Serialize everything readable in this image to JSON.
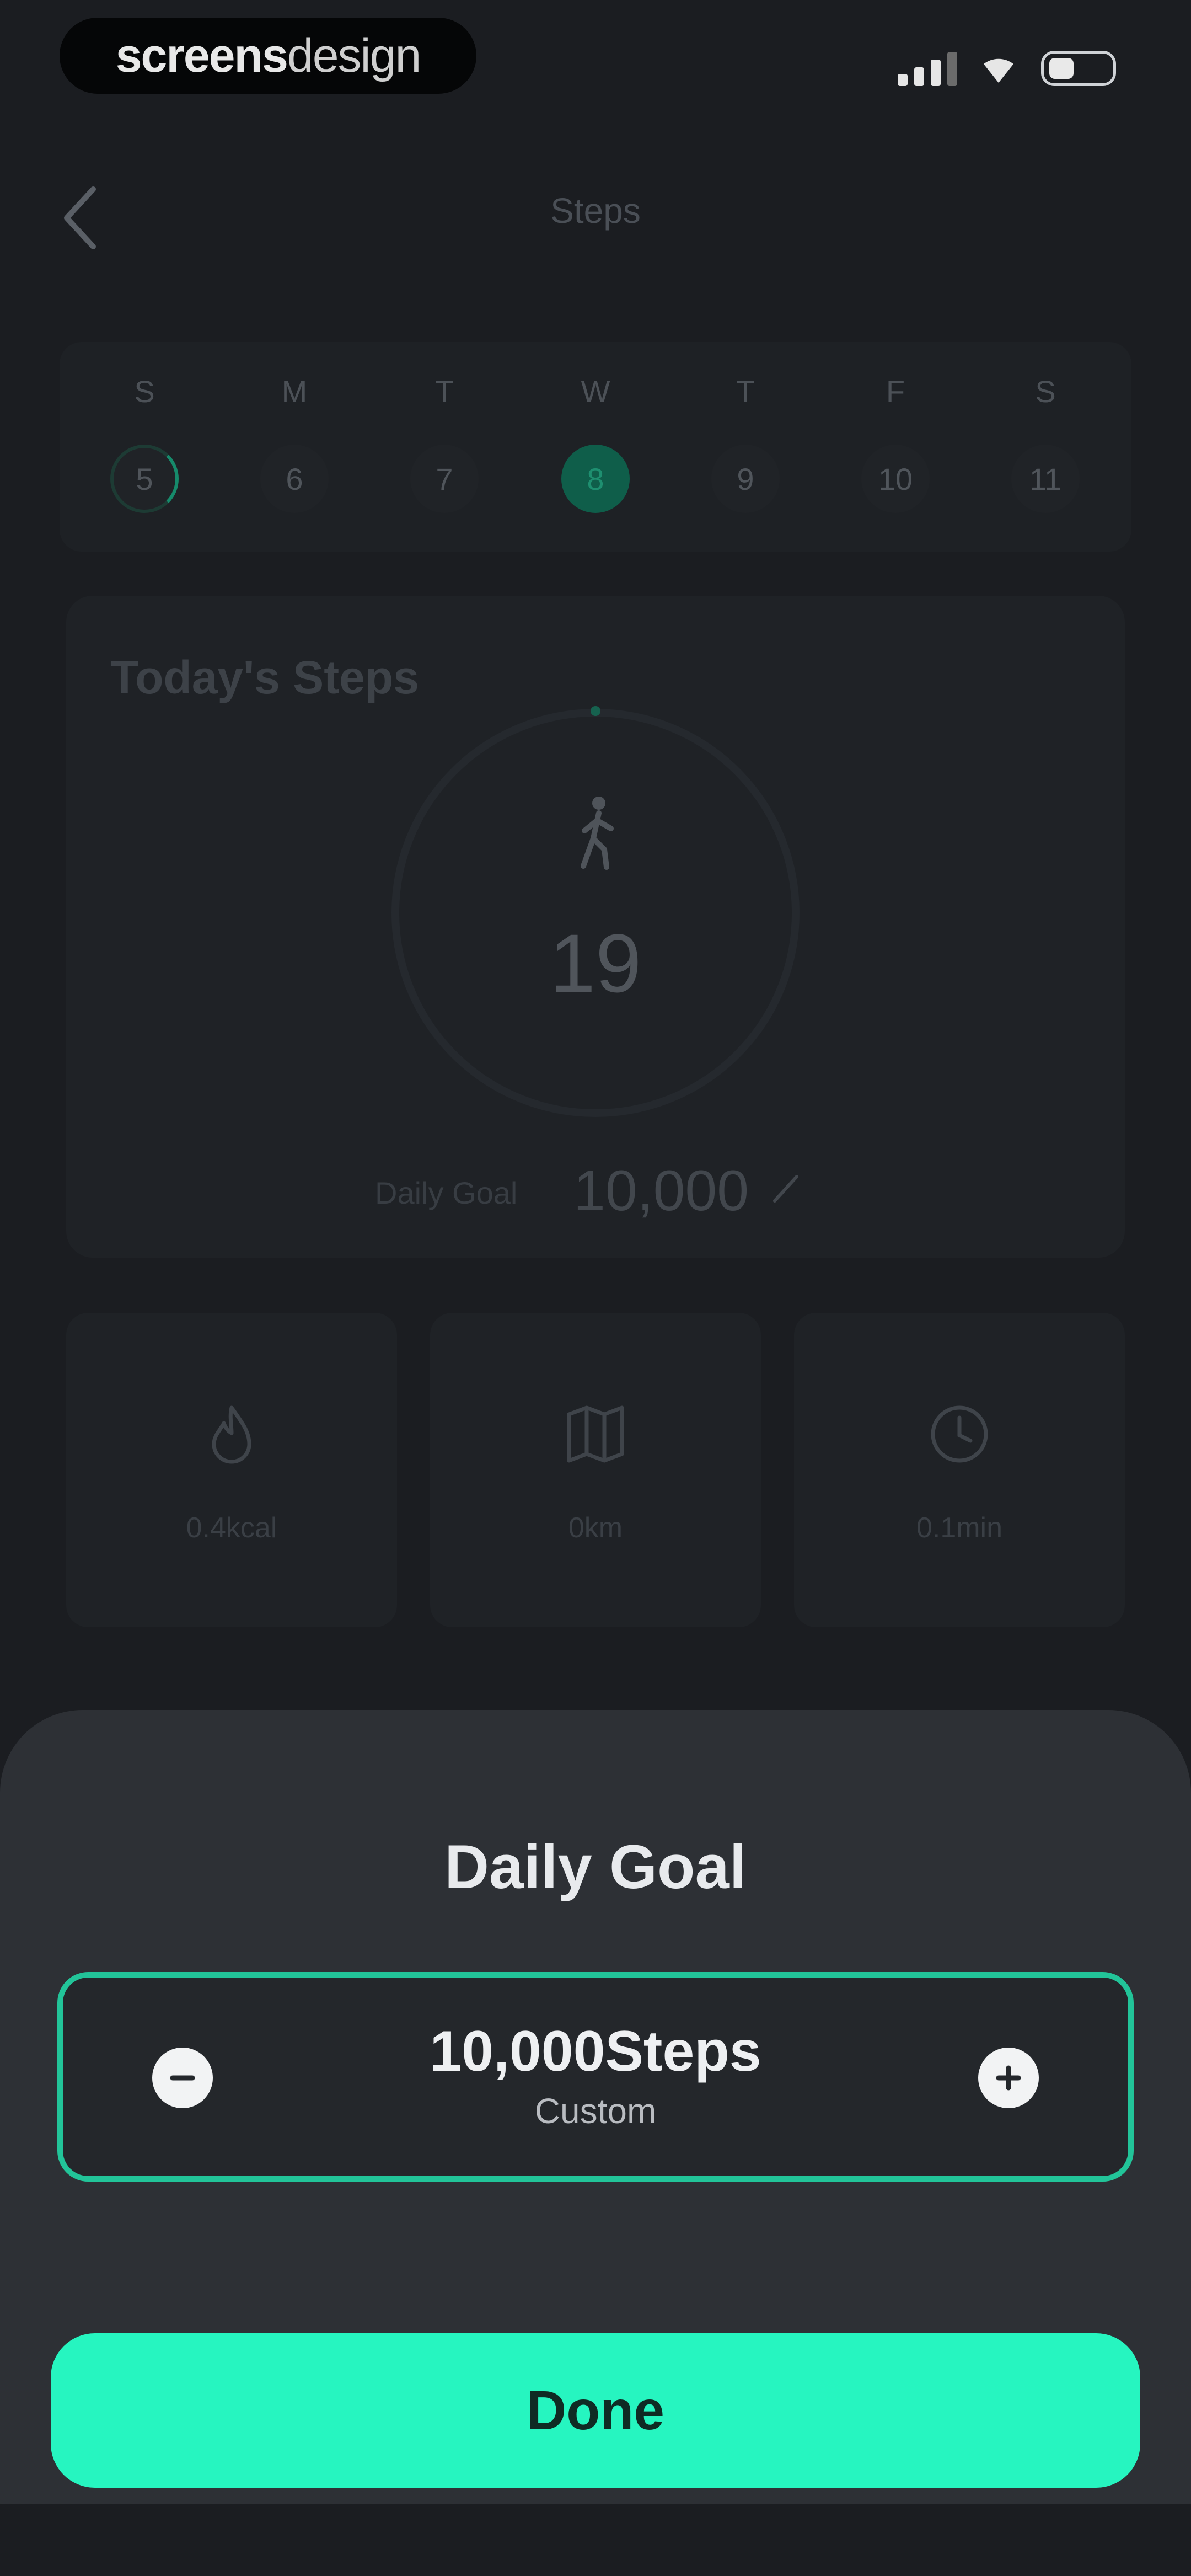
{
  "status_bar": {
    "brand_bold": "screens",
    "brand_light": "design"
  },
  "header": {
    "title": "Steps"
  },
  "week": [
    {
      "letter": "S",
      "date": "5"
    },
    {
      "letter": "M",
      "date": "6"
    },
    {
      "letter": "T",
      "date": "7"
    },
    {
      "letter": "W",
      "date": "8"
    },
    {
      "letter": "T",
      "date": "9"
    },
    {
      "letter": "F",
      "date": "10"
    },
    {
      "letter": "S",
      "date": "11"
    }
  ],
  "today": {
    "heading": "Today's Steps",
    "count": "19",
    "goal_label": "Daily Goal",
    "goal_value": "10,000"
  },
  "stats": [
    {
      "icon": "flame-icon",
      "value": "0.4kcal"
    },
    {
      "icon": "map-icon",
      "value": "0km"
    },
    {
      "icon": "clock-icon",
      "value": "0.1min"
    }
  ],
  "sheet": {
    "title": "Daily Goal",
    "value": "10,000Steps",
    "sub": "Custom",
    "done_label": "Done"
  },
  "colors": {
    "accent": "#26f5c0",
    "accent_border": "#22c499",
    "background": "#1b1d21",
    "sheet": "#2d3035"
  }
}
